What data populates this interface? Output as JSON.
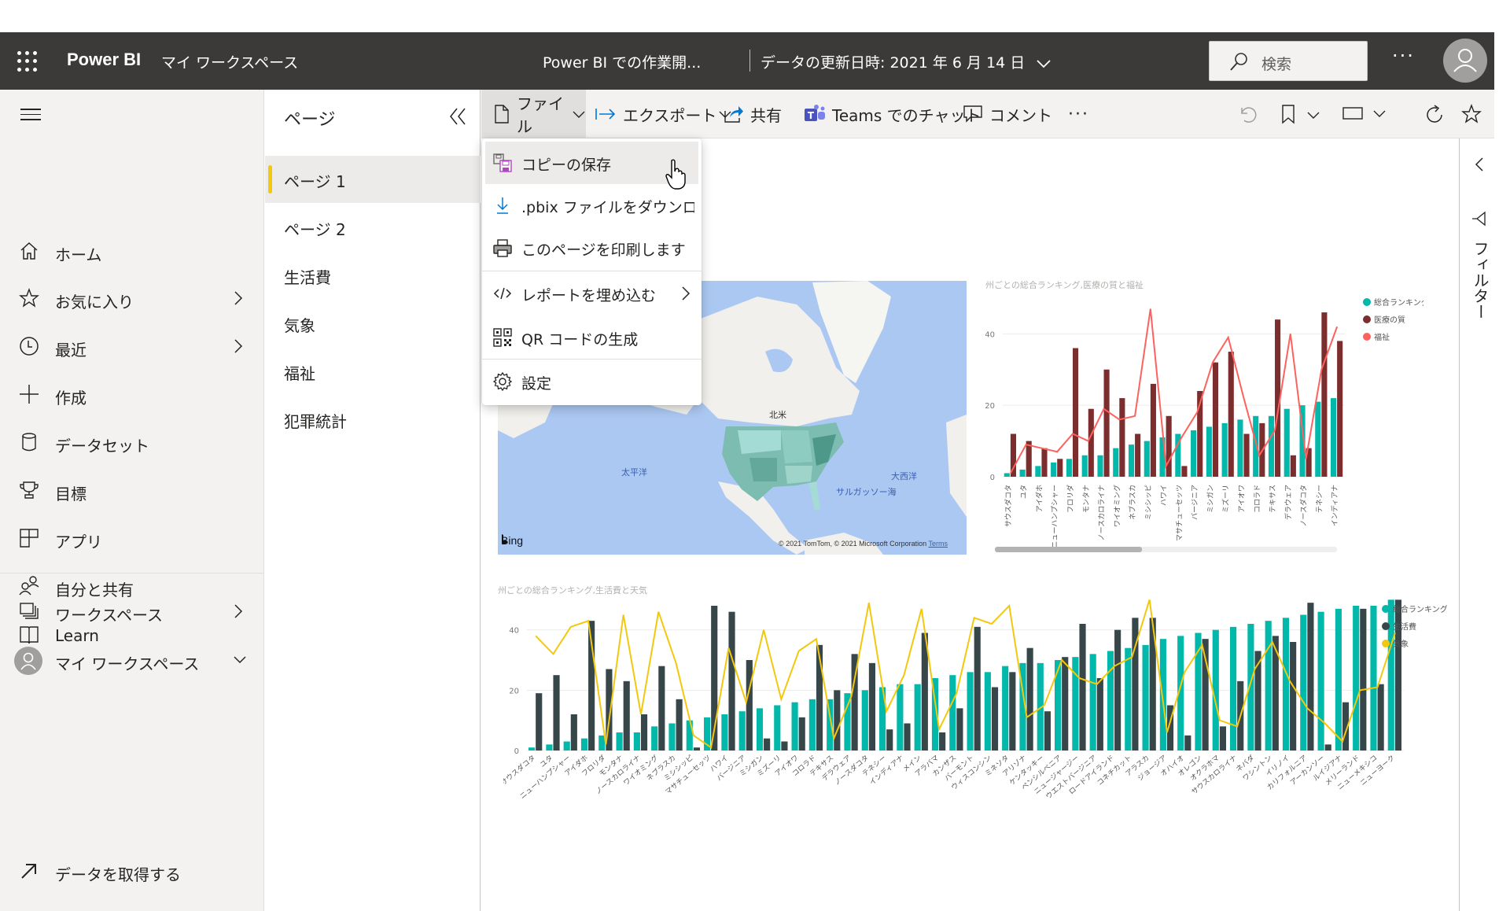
{
  "header": {
    "app_name": "Power BI",
    "workspace": "マイ ワークスペース",
    "report_title": "Power BI での作業開...",
    "refresh_info": "データの更新日時: 2021 年 6 月 14 日",
    "search_placeholder": "検索",
    "more_label": "···"
  },
  "leftnav": {
    "items": [
      {
        "label": "ホーム",
        "icon": "home-icon"
      },
      {
        "label": "お気に入り",
        "icon": "star-icon",
        "chevron": true
      },
      {
        "label": "最近",
        "icon": "clock-icon",
        "chevron": true
      },
      {
        "label": "作成",
        "icon": "plus-icon"
      },
      {
        "label": "データセット",
        "icon": "database-icon"
      },
      {
        "label": "目標",
        "icon": "trophy-icon"
      },
      {
        "label": "アプリ",
        "icon": "apps-icon"
      },
      {
        "label": "自分と共有",
        "icon": "shared-people-icon"
      },
      {
        "label": "Learn",
        "icon": "book-icon"
      }
    ],
    "workspaces_label": "ワークスペース",
    "my_workspace_label": "マイ ワークスペース",
    "get_data_label": "データを取得する"
  },
  "pages": {
    "title": "ページ",
    "items": [
      "ページ 1",
      "ページ 2",
      "生活費",
      "気象",
      "福祉",
      "犯罪統計"
    ],
    "active_index": 0
  },
  "toolbar": {
    "file": "ファイル",
    "export": "エクスポート",
    "share": "共有",
    "teams": "Teams でのチャット",
    "comment": "コメント",
    "more": "···"
  },
  "file_menu": {
    "items": [
      {
        "label": "コピーの保存",
        "icon": "save-copy-icon"
      },
      {
        "label": ".pbix ファイルをダウンロード...",
        "icon": "download-icon"
      },
      {
        "label": "このページを印刷します",
        "icon": "print-icon"
      },
      {
        "label": "レポートを埋め込む",
        "icon": "embed-code-icon",
        "submenu": true
      },
      {
        "label": "QR コードの生成",
        "icon": "qr-code-icon"
      },
      {
        "label": "設定",
        "icon": "gear-icon"
      }
    ]
  },
  "filters": {
    "label": "フィルター"
  },
  "map": {
    "labels": {
      "north_america": "北米",
      "pacific": "太平洋",
      "atlantic": "大西洋",
      "sargasso": "サルガッソー海"
    },
    "bing": "Bing",
    "copyright": "© 2021 TomTom, © 2021 Microsoft Corporation",
    "terms": "Terms"
  },
  "colors": {
    "teal": "#01b8aa",
    "maroon": "#7c2d2d",
    "red_line": "#fd625e",
    "dark": "#374649",
    "yellow": "#f2c80f",
    "accent_page": "#f2c811"
  },
  "chart_data": [
    {
      "type": "bar",
      "title": "州ごとの総合ランキング,医療の質と福祉",
      "ylim": [
        0,
        48
      ],
      "yticks": [
        "0",
        "20",
        "40"
      ],
      "grid": true,
      "legend_position": "top-right",
      "categories": [
        "サウスダコタ",
        "ユタ",
        "アイダホ",
        "ニューハンプシャー",
        "フロリダ",
        "モンタナ",
        "ノースカロライナ",
        "ワイオミング",
        "ネブラスカ",
        "ミシシッピ",
        "ハワイ",
        "マサチューセッツ",
        "バージニア",
        "ミシガン",
        "ミズーリ",
        "アイオワ",
        "コロラド",
        "テキサス",
        "デラウェア",
        "ノースダコタ",
        "テネシー",
        "インディアナ"
      ],
      "series": [
        {
          "name": "総合ランキング",
          "kind": "bar",
          "color": "#01b8aa",
          "values": [
            1,
            2,
            3,
            4,
            5,
            6,
            6,
            8,
            9,
            10,
            11,
            12,
            13,
            14,
            15,
            16,
            17,
            17,
            19,
            20,
            21,
            22
          ]
        },
        {
          "name": "医療の質",
          "kind": "bar",
          "color": "#7c2d2d",
          "values": [
            12,
            10,
            8,
            5,
            36,
            19,
            30,
            22,
            12,
            26,
            17,
            3,
            24,
            32,
            35,
            12,
            15,
            44,
            6,
            8,
            46,
            38
          ]
        },
        {
          "name": "福祉",
          "kind": "line",
          "color": "#fd625e",
          "values": [
            1,
            9,
            8,
            7,
            12,
            10,
            19,
            16,
            17,
            47,
            3,
            11,
            18,
            32,
            39,
            22,
            6,
            13,
            40,
            5,
            30,
            42
          ]
        }
      ],
      "scrollbar_fraction": 0.43
    },
    {
      "type": "bar",
      "title": "州ごとの総合ランキング,生活費と天気",
      "ylim": [
        0,
        48
      ],
      "yticks": [
        "0",
        "20",
        "40"
      ],
      "grid": true,
      "legend_position": "top-right",
      "categories": [
        "サウスダコタ",
        "ユタ",
        "ニューハンプシャー",
        "アイダホ",
        "フロリダ",
        "モンタナ",
        "ノースカロライナ",
        "ワイオミング",
        "ネブラスカ",
        "ミシシッピ",
        "マサチューセッツ",
        "ハワイ",
        "バージニア",
        "ミシガン",
        "ミズーリ",
        "アイオワ",
        "コロラド",
        "テキサス",
        "デラウェア",
        "ノースダコタ",
        "テネシー",
        "インディアナ",
        "メイン",
        "アラバマ",
        "カンザス",
        "バーモント",
        "ウィスコンシン",
        "ミネソタ",
        "アリゾナ",
        "ケンタッキー",
        "ペンシルベニア",
        "ニュージャージー",
        "ウエストバージニア",
        "ロードアイランド",
        "コネチカット",
        "アラスカ",
        "ジョージア",
        "オハイオ",
        "オレゴン",
        "オクラホマ",
        "サウスカロライナ",
        "ネバダ",
        "ワシントン",
        "イリノイ",
        "カリフォルニア",
        "アーカンソー",
        "ルイジアナ",
        "メリーランド",
        "ニューメキシコ",
        "ニューヨーク"
      ],
      "series": [
        {
          "name": "総合ランキング",
          "kind": "bar",
          "color": "#01b8aa",
          "values": [
            1,
            2,
            3,
            4,
            5,
            6,
            6,
            8,
            9,
            10,
            11,
            12,
            13,
            14,
            15,
            16,
            17,
            17,
            19,
            20,
            21,
            22,
            22,
            24,
            25,
            26,
            26,
            28,
            29,
            29,
            30,
            31,
            32,
            33,
            34,
            35,
            37,
            38,
            39,
            40,
            41,
            42,
            43,
            44,
            45,
            46,
            47,
            48,
            48,
            50
          ]
        },
        {
          "name": "生活費",
          "kind": "bar",
          "color": "#374649",
          "values": [
            19,
            25,
            12,
            43,
            27,
            23,
            12,
            28,
            17,
            1,
            48,
            46,
            30,
            4,
            3,
            11,
            35,
            20,
            32,
            29,
            7,
            9,
            39,
            6,
            14,
            41,
            21,
            26,
            34,
            13,
            31,
            42,
            24,
            40,
            44,
            44,
            15,
            5,
            37,
            8,
            23,
            33,
            38,
            36,
            49,
            2,
            16,
            47,
            22,
            50
          ]
        },
        {
          "name": "気象",
          "kind": "line",
          "color": "#f2c80f",
          "values": [
            38,
            32,
            41,
            43,
            2,
            45,
            12,
            46,
            29,
            5,
            1,
            34,
            16,
            40,
            17,
            33,
            37,
            4,
            18,
            49,
            13,
            25,
            47,
            7,
            19,
            44,
            42,
            48,
            11,
            15,
            30,
            24,
            22,
            28,
            31,
            50,
            6,
            26,
            35,
            10,
            8,
            27,
            36,
            23,
            14,
            9,
            3,
            20,
            21,
            39
          ]
        }
      ]
    }
  ]
}
